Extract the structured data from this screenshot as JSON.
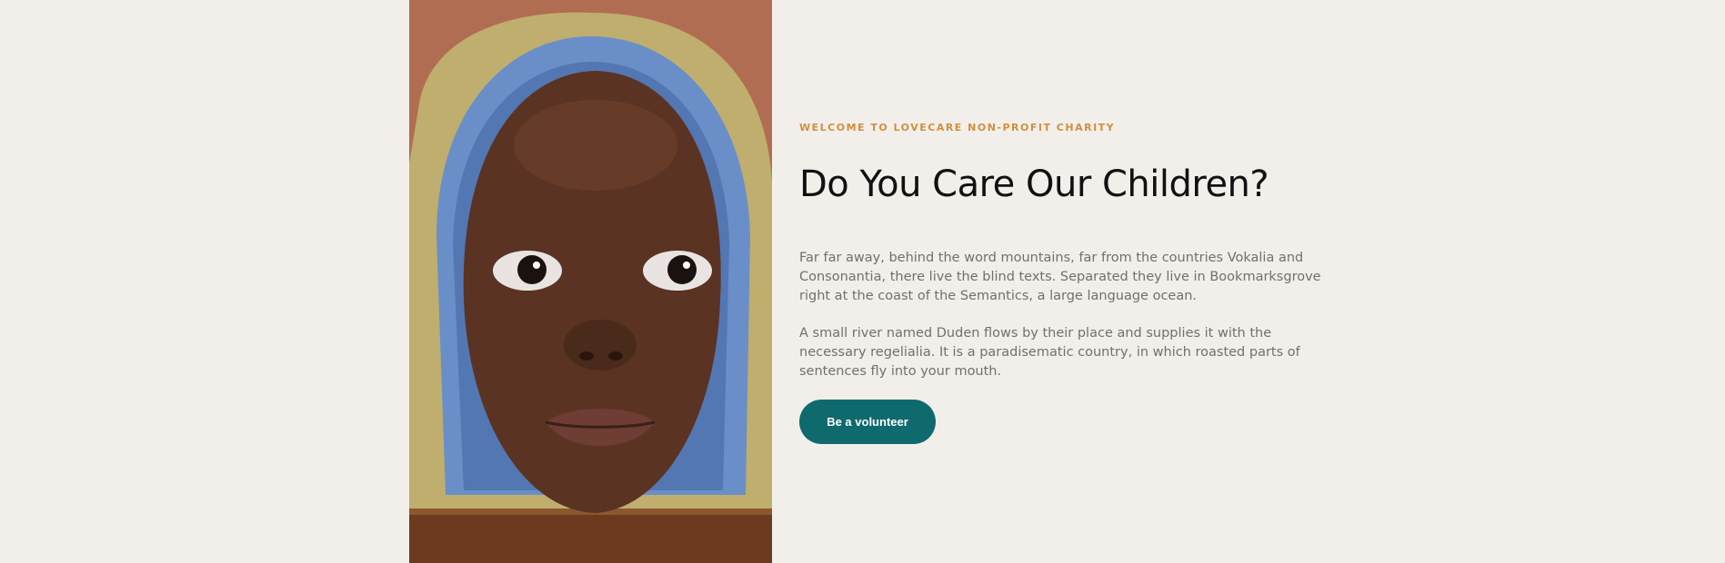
{
  "about": {
    "kicker": "Welcome to Lovecare non-profit charity",
    "title": "Do You Care Our Children?",
    "paragraph_1": "Far far away, behind the word mountains, far from the countries Vokalia and Consonantia, there live the blind texts. Separated they live in Bookmarksgrove right at the coast of the Semantics, a large language ocean.",
    "paragraph_2": "A small river named Duden flows by their place and supplies it with the necessary regelialia. It is a paradisematic country, in which roasted parts of sentences fly into your mouth.",
    "cta_label": "Be a volunteer"
  },
  "colors": {
    "background": "#f2efeb",
    "kicker": "#d18f3d",
    "button": "#0f6a6e"
  }
}
